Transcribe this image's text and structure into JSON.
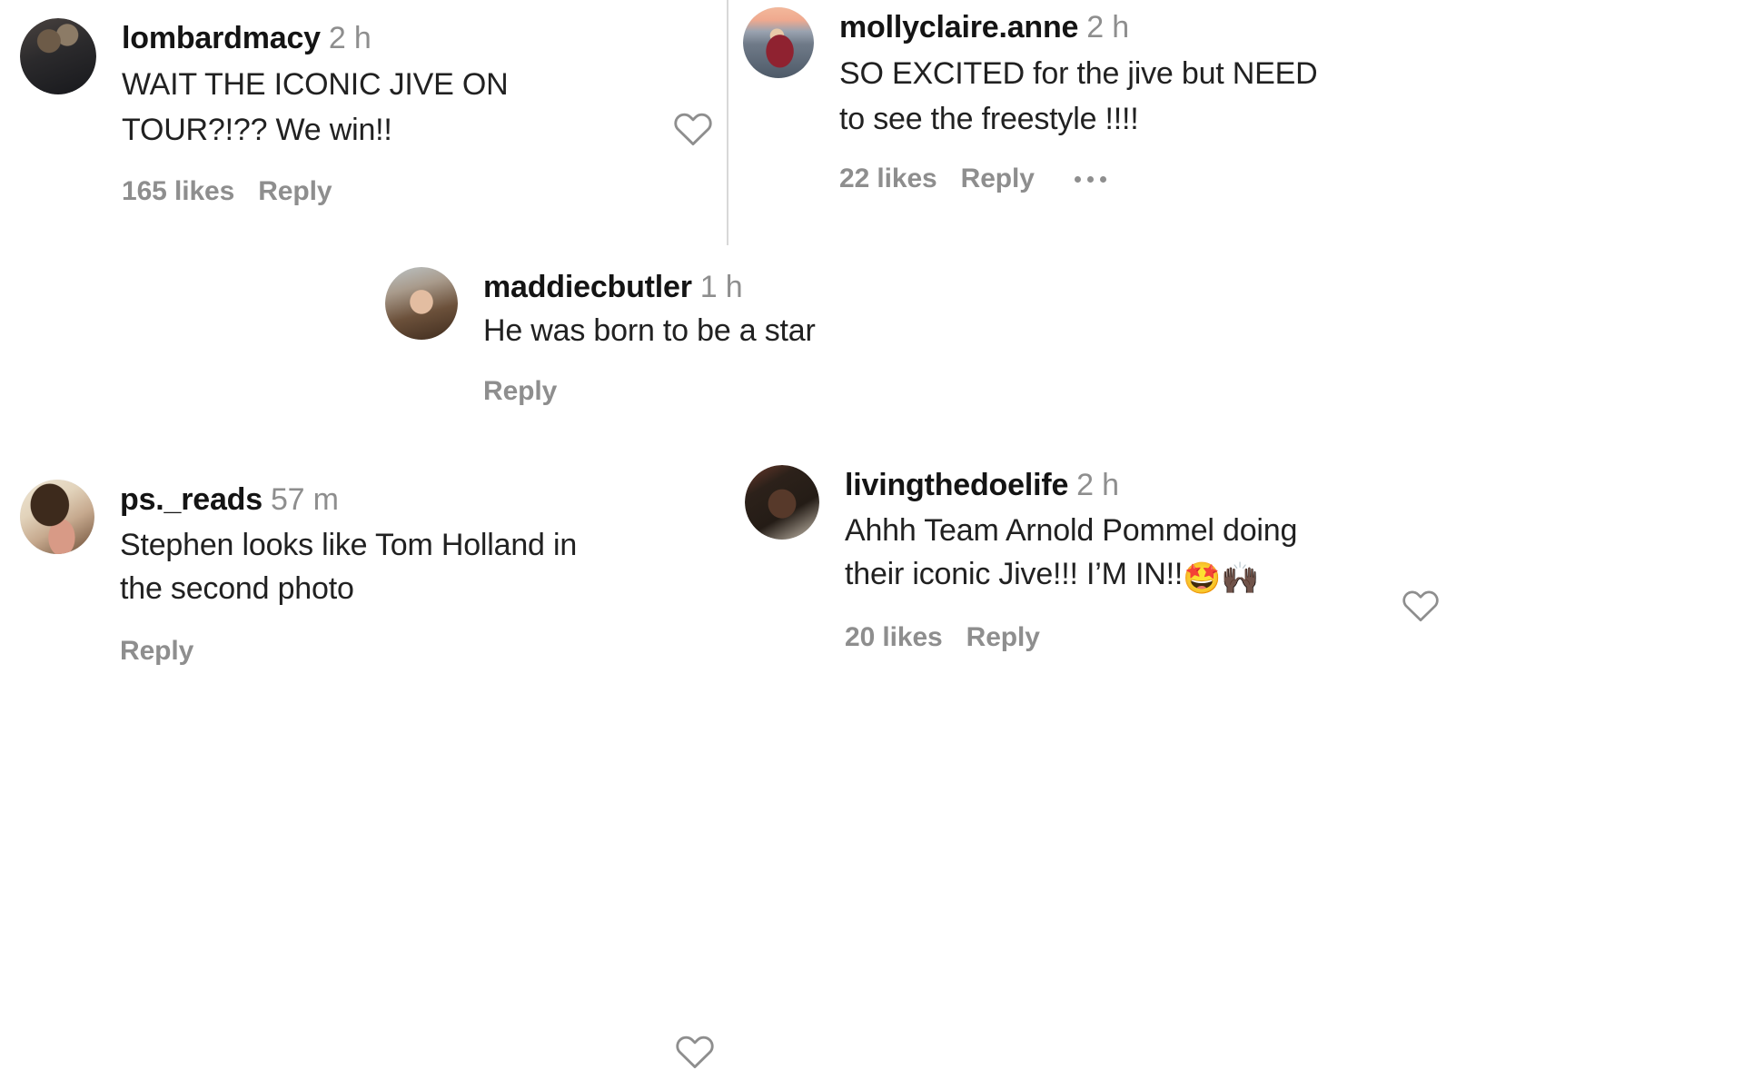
{
  "app": {
    "name": "instagram-comments",
    "background": "#ffffff",
    "text_color": "#212121",
    "muted_color": "#8e8e8e",
    "divider_color": "#d8d8d8"
  },
  "labels": {
    "reply": "Reply",
    "more_options": "•••",
    "like_icon": "heart-outline-icon"
  },
  "comments": [
    {
      "id": "c1",
      "username": "lombardmacy",
      "timestamp": "2 h",
      "text": "WAIT THE ICONIC JIVE ON\nTOUR?!?? We win!!",
      "likes": "165 likes",
      "reply": "Reply",
      "has_more": false,
      "avatar_colors": [
        "#3c3a38",
        "#17181c",
        "#8c7b66"
      ]
    },
    {
      "id": "c2",
      "username": "mollyclaire.anne",
      "timestamp": "2 h",
      "text": "SO EXCITED for the jive but NEED\nto see the freestyle !!!!",
      "likes": "22 likes",
      "reply": "Reply",
      "has_more": true,
      "more": "•••",
      "avatar_colors": [
        "#f0b49a",
        "#8f2230",
        "#566070"
      ]
    },
    {
      "id": "c3",
      "username": "maddiecbutler",
      "timestamp": "1 h",
      "text": "He was born to be a star",
      "likes": "",
      "reply": "Reply",
      "has_more": false,
      "avatar_colors": [
        "#b9b2a6",
        "#4e3a2b",
        "#8e7a66"
      ]
    },
    {
      "id": "c4",
      "username": "ps._reads",
      "timestamp": "57 m",
      "text": "Stephen looks like Tom Holland in\nthe second photo",
      "likes": "",
      "reply": "Reply",
      "has_more": false,
      "avatar_colors": [
        "#efe3cf",
        "#3d2a1c",
        "#c08c76"
      ]
    },
    {
      "id": "c5",
      "username": "livingthedoelife",
      "timestamp": "2 h",
      "text_before_emoji": "Ahhh Team Arnold Pommel doing\ntheir iconic Jive!!! I’M IN!!",
      "emoji": "🤩🙌🏿",
      "likes": "20 likes",
      "reply": "Reply",
      "has_more": false,
      "avatar_colors": [
        "#2b2018",
        "#6b3a2e",
        "#d8cfc2"
      ]
    }
  ]
}
